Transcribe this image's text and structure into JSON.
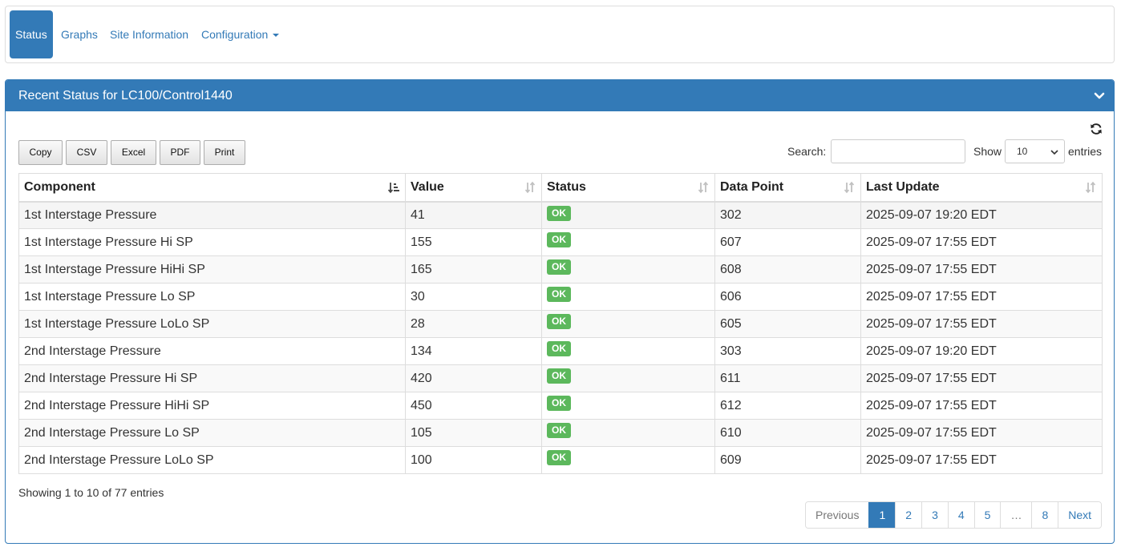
{
  "nav": {
    "items": [
      "Status",
      "Graphs",
      "Site Information",
      "Configuration"
    ],
    "active": "Status"
  },
  "panel": {
    "title": "Recent Status for LC100/Control1440"
  },
  "toolbar": {
    "buttons": [
      "Copy",
      "CSV",
      "Excel",
      "PDF",
      "Print"
    ],
    "search_label": "Search:",
    "search_value": "",
    "show_label": "Show",
    "page_size": "10",
    "entries_label": "entries"
  },
  "table": {
    "columns": [
      "Component",
      "Value",
      "Status",
      "Data Point",
      "Last Update"
    ],
    "rows": [
      {
        "component": "1st Interstage Pressure",
        "value": "41",
        "status": "OK",
        "data_point": "302",
        "last_update": "2025-09-07 19:20 EDT"
      },
      {
        "component": "1st Interstage Pressure Hi SP",
        "value": "155",
        "status": "OK",
        "data_point": "607",
        "last_update": "2025-09-07 17:55 EDT"
      },
      {
        "component": "1st Interstage Pressure HiHi SP",
        "value": "165",
        "status": "OK",
        "data_point": "608",
        "last_update": "2025-09-07 17:55 EDT"
      },
      {
        "component": "1st Interstage Pressure Lo SP",
        "value": "30",
        "status": "OK",
        "data_point": "606",
        "last_update": "2025-09-07 17:55 EDT"
      },
      {
        "component": "1st Interstage Pressure LoLo SP",
        "value": "28",
        "status": "OK",
        "data_point": "605",
        "last_update": "2025-09-07 17:55 EDT"
      },
      {
        "component": "2nd Interstage Pressure",
        "value": "134",
        "status": "OK",
        "data_point": "303",
        "last_update": "2025-09-07 19:20 EDT"
      },
      {
        "component": "2nd Interstage Pressure Hi SP",
        "value": "420",
        "status": "OK",
        "data_point": "611",
        "last_update": "2025-09-07 17:55 EDT"
      },
      {
        "component": "2nd Interstage Pressure HiHi SP",
        "value": "450",
        "status": "OK",
        "data_point": "612",
        "last_update": "2025-09-07 17:55 EDT"
      },
      {
        "component": "2nd Interstage Pressure Lo SP",
        "value": "105",
        "status": "OK",
        "data_point": "610",
        "last_update": "2025-09-07 17:55 EDT"
      },
      {
        "component": "2nd Interstage Pressure LoLo SP",
        "value": "100",
        "status": "OK",
        "data_point": "609",
        "last_update": "2025-09-07 17:55 EDT"
      }
    ]
  },
  "footer": {
    "info": "Showing 1 to 10 of 77 entries"
  },
  "pagination": {
    "previous": "Previous",
    "pages": [
      "1",
      "2",
      "3",
      "4",
      "5",
      "…",
      "8"
    ],
    "current": "1",
    "next": "Next"
  },
  "icons": {
    "collapse": "chevron-down-icon",
    "refresh": "refresh-icon",
    "sort": "sort-icon",
    "sort_active": "sort-ascending-icon",
    "select": "chevron-down-icon"
  },
  "colors": {
    "primary": "#337ab7",
    "ok_badge": "#5cb85c"
  }
}
